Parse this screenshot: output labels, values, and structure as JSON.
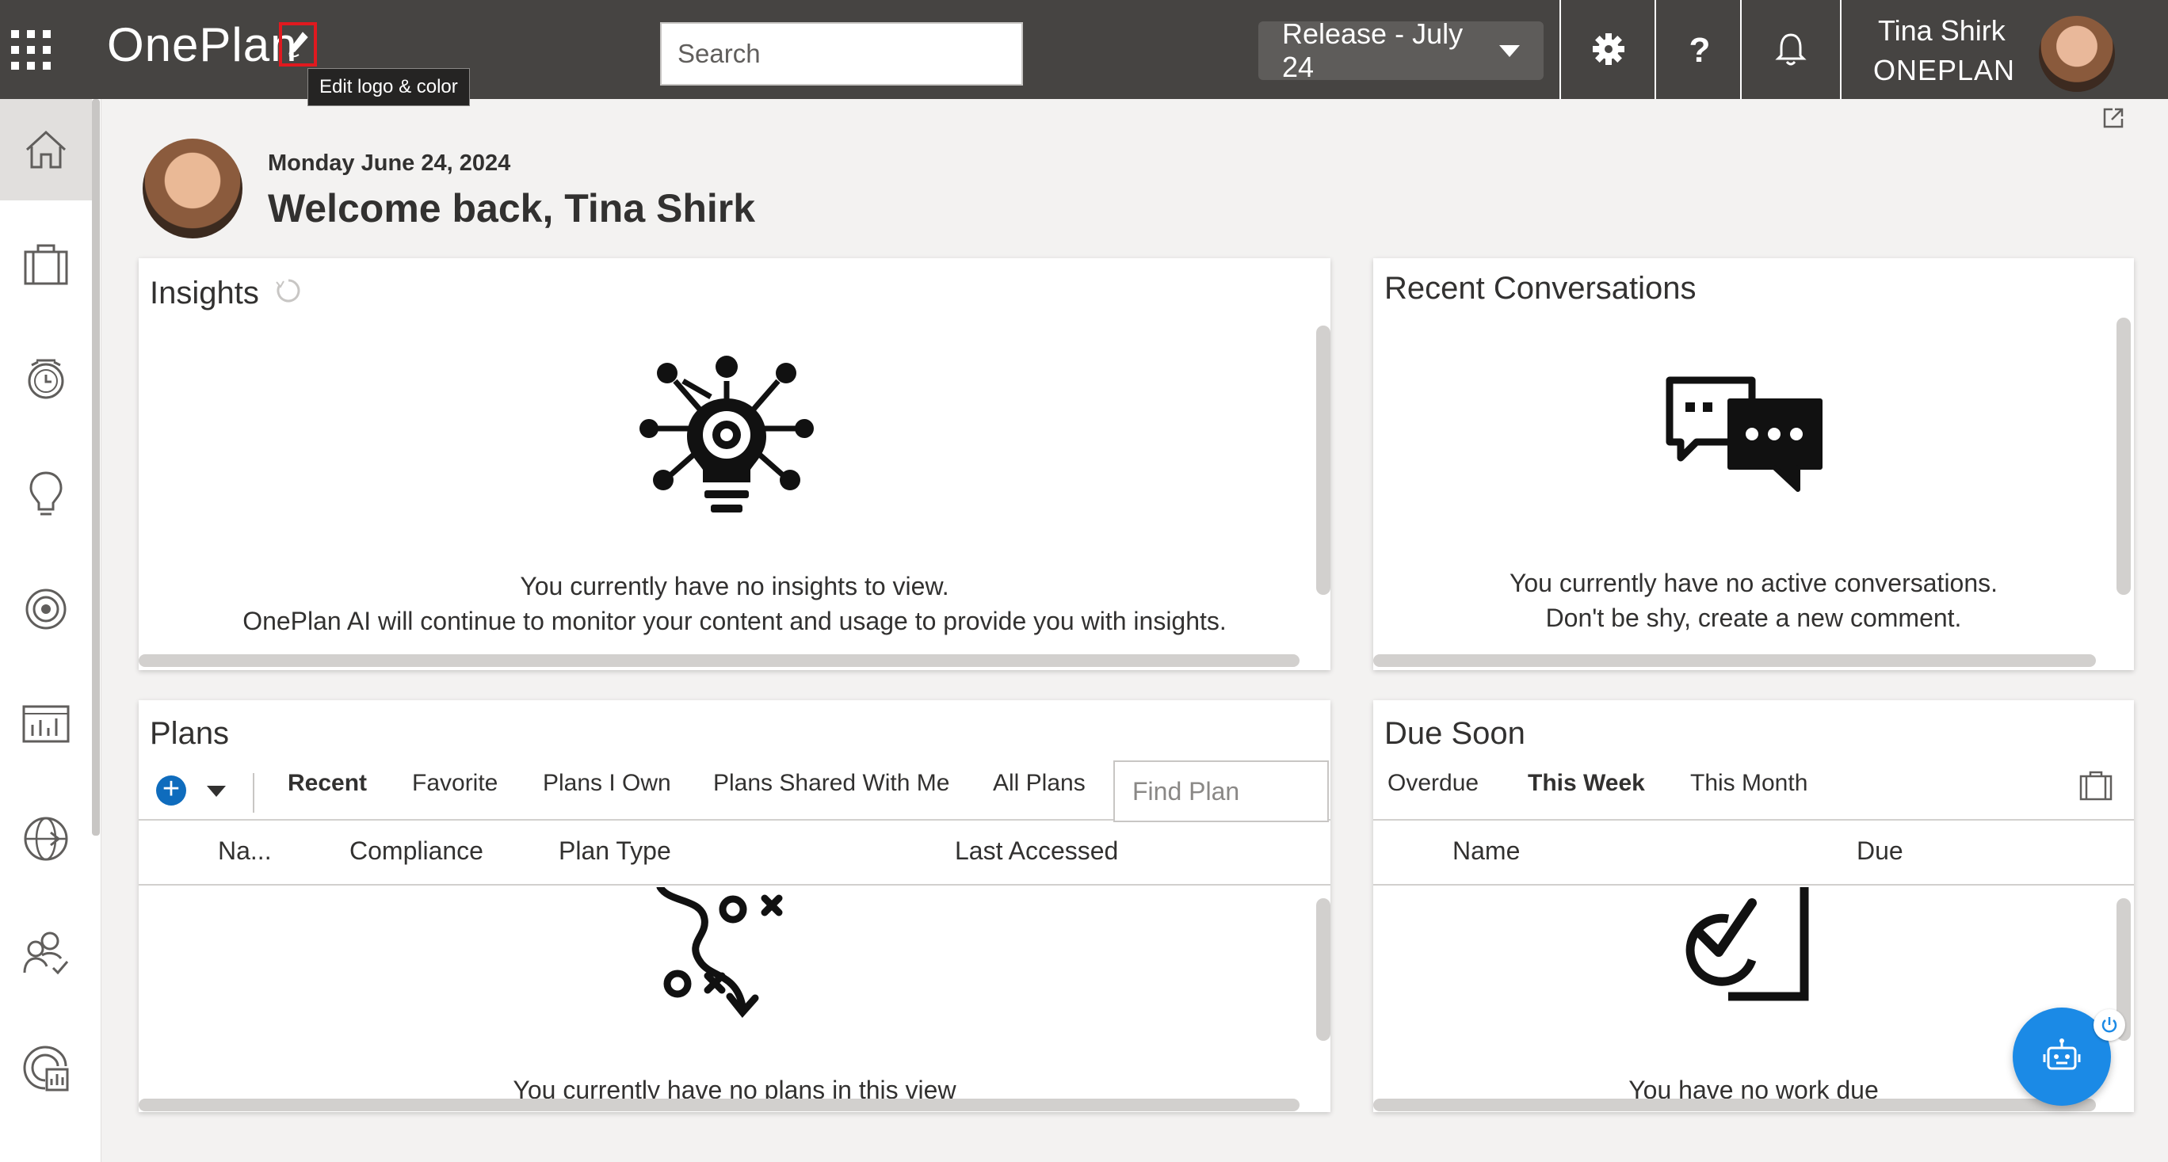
{
  "app": {
    "brand": "OnePlan",
    "edit_logo_tooltip": "Edit logo & color"
  },
  "header": {
    "search_placeholder": "Search",
    "release_label": "Release - July 24",
    "user_name": "Tina Shirk",
    "user_org": "ONEPLAN"
  },
  "welcome": {
    "date": "Monday June 24, 2024",
    "title": "Welcome back, Tina Shirk"
  },
  "insights": {
    "title": "Insights",
    "empty_line1": "You currently have no insights to view.",
    "empty_line2": "OnePlan AI will continue to monitor your content and usage to provide you with insights."
  },
  "conversations": {
    "title": "Recent Conversations",
    "empty_line1": "You currently have no active conversations.",
    "empty_line2": "Don't be shy, create a new comment."
  },
  "plans": {
    "title": "Plans",
    "tabs": [
      "Recent",
      "Favorite",
      "Plans I Own",
      "Plans Shared With Me",
      "All Plans"
    ],
    "active_tab": "Recent",
    "find_placeholder": "Find Plan",
    "columns": [
      "Na...",
      "Compliance",
      "Plan Type",
      "Last Accessed"
    ],
    "empty": "You currently have no plans in this view"
  },
  "due_soon": {
    "title": "Due Soon",
    "tabs": [
      "Overdue",
      "This Week",
      "This Month"
    ],
    "active_tab": "This Week",
    "columns": [
      "Name",
      "Due"
    ],
    "empty": "You have no work due"
  },
  "colors": {
    "topbar": "#464442",
    "accent": "#1b8ae6",
    "highlight": "#e0191f"
  },
  "icons": {
    "rail": [
      "home-icon",
      "portfolio-icon",
      "timesheet-icon",
      "ideas-icon",
      "goals-icon",
      "reports-icon",
      "globe-icon",
      "resources-icon",
      "analytics-icon"
    ]
  }
}
